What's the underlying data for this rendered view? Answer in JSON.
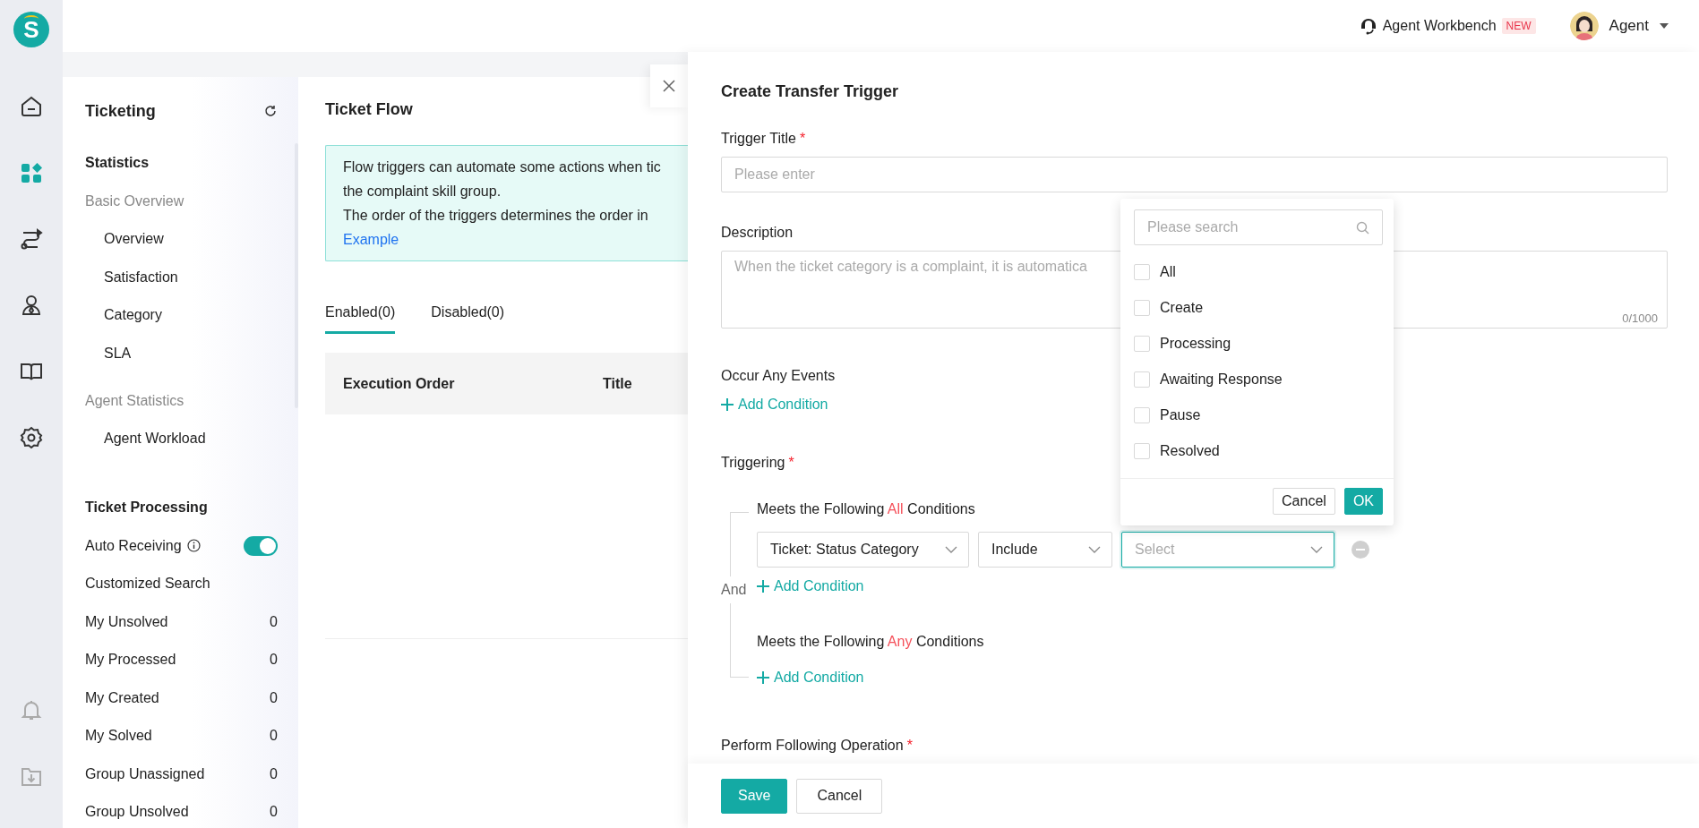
{
  "logo": "S",
  "rail": {
    "top": [
      {
        "selected": false
      },
      {
        "selected": true
      },
      {
        "selected": false
      },
      {
        "selected": false
      },
      {
        "selected": false
      },
      {
        "selected": false
      }
    ],
    "bottom": [
      {
        "selected": false
      },
      {
        "selected": false
      }
    ]
  },
  "header": {
    "workbench": "Agent Workbench",
    "badge": "NEW",
    "user": "Agent"
  },
  "nav": {
    "title": "Ticketing",
    "section": "Statistics",
    "groups": [
      {
        "label": "Basic Overview",
        "items": [
          "Overview",
          "Satisfaction",
          "Category",
          "SLA"
        ]
      },
      {
        "label": "Agent Statistics",
        "items": [
          "Agent Workload"
        ]
      }
    ],
    "processing_title": "Ticket Processing",
    "processing": [
      {
        "kind": "toggle",
        "label": "Auto Receiving",
        "on": true
      },
      {
        "kind": "link",
        "label": "Customized Search"
      },
      {
        "kind": "count",
        "label": "My Unsolved",
        "count": "0"
      },
      {
        "kind": "count",
        "label": "My Processed",
        "count": "0"
      },
      {
        "kind": "count",
        "label": "My Created",
        "count": "0"
      },
      {
        "kind": "count",
        "label": "My Solved",
        "count": "0"
      },
      {
        "kind": "count",
        "label": "Group Unassigned",
        "count": "0"
      },
      {
        "kind": "count",
        "label": "Group Unsolved",
        "count": "0"
      }
    ]
  },
  "flow": {
    "title": "Ticket Flow",
    "notice": [
      "Flow triggers can automate some actions when tic",
      "the complaint skill group.",
      "The order of the triggers determines the order in"
    ],
    "notice_link": "Example",
    "tabs": [
      {
        "label": "Enabled(0)",
        "selected": true
      },
      {
        "label": "Disabled(0)",
        "selected": false
      }
    ],
    "columns": [
      "Execution Order",
      "Title"
    ]
  },
  "drawer": {
    "title": "Create Transfer Trigger",
    "trigger_title": {
      "label": "Trigger Title",
      "required_mark": "*",
      "placeholder": "Please enter"
    },
    "description": {
      "label": "Description",
      "placeholder": "When the ticket category is a complaint, it is automatica",
      "counter": "0/1000"
    },
    "events": {
      "label": "Occur Any Events",
      "add": "Add Condition"
    },
    "triggering": {
      "label": "Triggering",
      "required_mark": "*",
      "joiner": "And",
      "groups": [
        {
          "before": "Meets the Following ",
          "emphasis": "All",
          "after": " Conditions",
          "conditions": [
            {
              "field": "Ticket: Status Category",
              "operator": "Include",
              "value_placeholder": "Select",
              "focused": true
            }
          ],
          "add": "Add Condition"
        },
        {
          "before": "Meets the Following ",
          "emphasis": "Any",
          "after": " Conditions",
          "add": "Add Condition"
        }
      ]
    },
    "operation": {
      "label": "Perform Following Operation",
      "required_mark": "*"
    },
    "save": "Save",
    "cancel": "Cancel"
  },
  "dropdown": {
    "search_placeholder": "Please search",
    "options": [
      {
        "label": "All",
        "checked": false
      },
      {
        "label": "Create",
        "checked": false
      },
      {
        "label": "Processing",
        "checked": false
      },
      {
        "label": "Awaiting Response",
        "checked": false
      },
      {
        "label": "Pause",
        "checked": false
      },
      {
        "label": "Resolved",
        "checked": false
      }
    ],
    "cancel": "Cancel",
    "ok": "OK"
  }
}
